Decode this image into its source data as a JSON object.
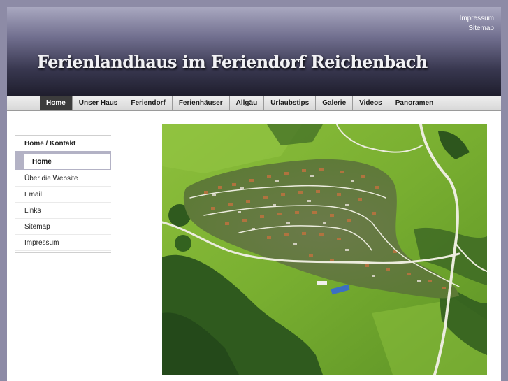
{
  "topnav": {
    "items": [
      "Impressum",
      "Sitemap"
    ]
  },
  "header": {
    "title": "Ferienlandhaus im Feriendorf Reichenbach"
  },
  "mainnav": {
    "items": [
      "Home",
      "Unser Haus",
      "Feriendorf",
      "Ferienhäuser",
      "Allgäu",
      "Urlaubstips",
      "Galerie",
      "Videos",
      "Panoramen"
    ],
    "active_index": 0
  },
  "sidebar": {
    "heading": "Home / Kontakt",
    "active_item": "Home",
    "items": [
      "Über die Website",
      "Email",
      "Links",
      "Sitemap",
      "Impressum"
    ]
  },
  "colors": {
    "page_background": "#8d8ba6",
    "header_dark": "#1e1d2c",
    "nav_active": "#3c3c3c",
    "sidebar_accent": "#b3b2c5"
  },
  "main": {
    "image": "aerial-view-village-icon"
  }
}
